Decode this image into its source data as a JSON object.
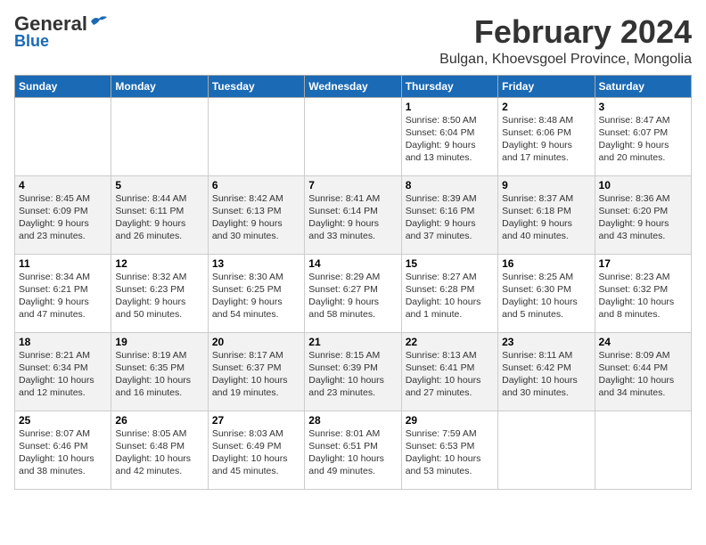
{
  "header": {
    "logo_general": "General",
    "logo_blue": "Blue",
    "main_title": "February 2024",
    "sub_title": "Bulgan, Khoevsgoel Province, Mongolia"
  },
  "days_of_week": [
    "Sunday",
    "Monday",
    "Tuesday",
    "Wednesday",
    "Thursday",
    "Friday",
    "Saturday"
  ],
  "weeks": [
    [
      {
        "day": "",
        "text": ""
      },
      {
        "day": "",
        "text": ""
      },
      {
        "day": "",
        "text": ""
      },
      {
        "day": "",
        "text": ""
      },
      {
        "day": "1",
        "text": "Sunrise: 8:50 AM\nSunset: 6:04 PM\nDaylight: 9 hours\nand 13 minutes."
      },
      {
        "day": "2",
        "text": "Sunrise: 8:48 AM\nSunset: 6:06 PM\nDaylight: 9 hours\nand 17 minutes."
      },
      {
        "day": "3",
        "text": "Sunrise: 8:47 AM\nSunset: 6:07 PM\nDaylight: 9 hours\nand 20 minutes."
      }
    ],
    [
      {
        "day": "4",
        "text": "Sunrise: 8:45 AM\nSunset: 6:09 PM\nDaylight: 9 hours\nand 23 minutes."
      },
      {
        "day": "5",
        "text": "Sunrise: 8:44 AM\nSunset: 6:11 PM\nDaylight: 9 hours\nand 26 minutes."
      },
      {
        "day": "6",
        "text": "Sunrise: 8:42 AM\nSunset: 6:13 PM\nDaylight: 9 hours\nand 30 minutes."
      },
      {
        "day": "7",
        "text": "Sunrise: 8:41 AM\nSunset: 6:14 PM\nDaylight: 9 hours\nand 33 minutes."
      },
      {
        "day": "8",
        "text": "Sunrise: 8:39 AM\nSunset: 6:16 PM\nDaylight: 9 hours\nand 37 minutes."
      },
      {
        "day": "9",
        "text": "Sunrise: 8:37 AM\nSunset: 6:18 PM\nDaylight: 9 hours\nand 40 minutes."
      },
      {
        "day": "10",
        "text": "Sunrise: 8:36 AM\nSunset: 6:20 PM\nDaylight: 9 hours\nand 43 minutes."
      }
    ],
    [
      {
        "day": "11",
        "text": "Sunrise: 8:34 AM\nSunset: 6:21 PM\nDaylight: 9 hours\nand 47 minutes."
      },
      {
        "day": "12",
        "text": "Sunrise: 8:32 AM\nSunset: 6:23 PM\nDaylight: 9 hours\nand 50 minutes."
      },
      {
        "day": "13",
        "text": "Sunrise: 8:30 AM\nSunset: 6:25 PM\nDaylight: 9 hours\nand 54 minutes."
      },
      {
        "day": "14",
        "text": "Sunrise: 8:29 AM\nSunset: 6:27 PM\nDaylight: 9 hours\nand 58 minutes."
      },
      {
        "day": "15",
        "text": "Sunrise: 8:27 AM\nSunset: 6:28 PM\nDaylight: 10 hours\nand 1 minute."
      },
      {
        "day": "16",
        "text": "Sunrise: 8:25 AM\nSunset: 6:30 PM\nDaylight: 10 hours\nand 5 minutes."
      },
      {
        "day": "17",
        "text": "Sunrise: 8:23 AM\nSunset: 6:32 PM\nDaylight: 10 hours\nand 8 minutes."
      }
    ],
    [
      {
        "day": "18",
        "text": "Sunrise: 8:21 AM\nSunset: 6:34 PM\nDaylight: 10 hours\nand 12 minutes."
      },
      {
        "day": "19",
        "text": "Sunrise: 8:19 AM\nSunset: 6:35 PM\nDaylight: 10 hours\nand 16 minutes."
      },
      {
        "day": "20",
        "text": "Sunrise: 8:17 AM\nSunset: 6:37 PM\nDaylight: 10 hours\nand 19 minutes."
      },
      {
        "day": "21",
        "text": "Sunrise: 8:15 AM\nSunset: 6:39 PM\nDaylight: 10 hours\nand 23 minutes."
      },
      {
        "day": "22",
        "text": "Sunrise: 8:13 AM\nSunset: 6:41 PM\nDaylight: 10 hours\nand 27 minutes."
      },
      {
        "day": "23",
        "text": "Sunrise: 8:11 AM\nSunset: 6:42 PM\nDaylight: 10 hours\nand 30 minutes."
      },
      {
        "day": "24",
        "text": "Sunrise: 8:09 AM\nSunset: 6:44 PM\nDaylight: 10 hours\nand 34 minutes."
      }
    ],
    [
      {
        "day": "25",
        "text": "Sunrise: 8:07 AM\nSunset: 6:46 PM\nDaylight: 10 hours\nand 38 minutes."
      },
      {
        "day": "26",
        "text": "Sunrise: 8:05 AM\nSunset: 6:48 PM\nDaylight: 10 hours\nand 42 minutes."
      },
      {
        "day": "27",
        "text": "Sunrise: 8:03 AM\nSunset: 6:49 PM\nDaylight: 10 hours\nand 45 minutes."
      },
      {
        "day": "28",
        "text": "Sunrise: 8:01 AM\nSunset: 6:51 PM\nDaylight: 10 hours\nand 49 minutes."
      },
      {
        "day": "29",
        "text": "Sunrise: 7:59 AM\nSunset: 6:53 PM\nDaylight: 10 hours\nand 53 minutes."
      },
      {
        "day": "",
        "text": ""
      },
      {
        "day": "",
        "text": ""
      }
    ]
  ]
}
